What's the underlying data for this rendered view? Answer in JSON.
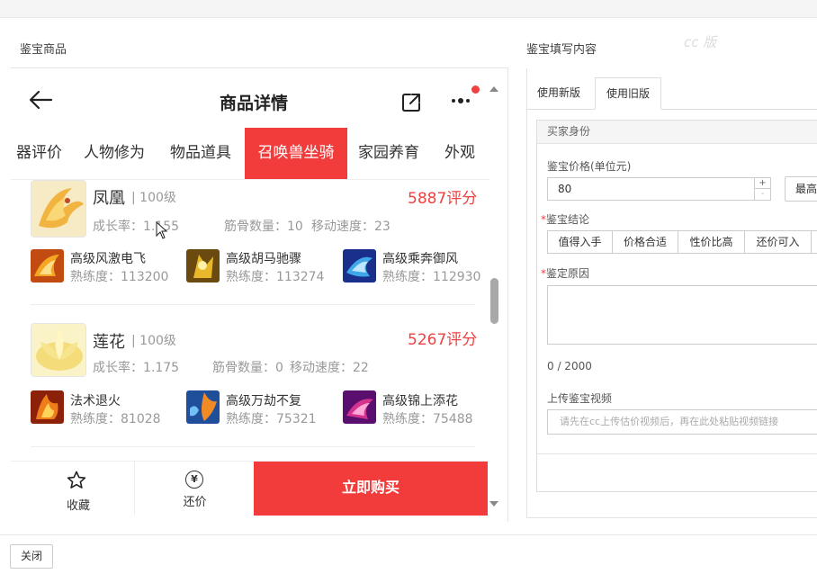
{
  "left_panel": {
    "title": "鉴宝商品"
  },
  "right_panel": {
    "title": "鉴宝填写内容",
    "watermark": "cc 版"
  },
  "phone": {
    "nav": {
      "title": "商品详情"
    },
    "tabs": [
      "器评价",
      "人物修为",
      "物品道具",
      "召唤兽坐骑",
      "家园养育",
      "外观"
    ],
    "active_tab": "召唤兽坐骑",
    "items": [
      {
        "name": "凤凰",
        "level": "| 100级",
        "score": "5887评分",
        "growth": "成长率：1.155",
        "bones": "筋骨数量：10",
        "speed": "移动速度：23",
        "skills": [
          {
            "name": "高级风激电飞",
            "prof": "熟练度：113200"
          },
          {
            "name": "高级胡马驰骤",
            "prof": "熟练度：113274"
          },
          {
            "name": "高级乘奔御风",
            "prof": "熟练度：112930"
          }
        ]
      },
      {
        "name": "莲花",
        "level": "| 100级",
        "score": "5267评分",
        "growth": "成长率：1.175",
        "bones": "筋骨数量：0",
        "speed": "移动速度：22",
        "skills": [
          {
            "name": "法术退火",
            "prof": "熟练度：81028"
          },
          {
            "name": "高级万劫不复",
            "prof": "熟练度：75321"
          },
          {
            "name": "高级锦上添花",
            "prof": "熟练度：75488"
          }
        ]
      }
    ],
    "bottom": {
      "favorite": "收藏",
      "bargain_symbol": "¥",
      "bargain": "还价",
      "buy": "立即购买"
    }
  },
  "form": {
    "tabs": [
      "使用新版",
      "使用旧版"
    ],
    "active_tab": "使用旧版",
    "buyer_section": "买家身份",
    "price_label": "鉴宝价格(单位元)",
    "price_value": "80",
    "step_up": "+",
    "step_down": "-",
    "max_button": "最高",
    "conclusion_label": "鉴宝结论",
    "conclusions": [
      "值得入手",
      "价格合适",
      "性价比高",
      "还价可入"
    ],
    "reason_label": "鉴定原因",
    "reason_counter": "0 / 2000",
    "video_label": "上传鉴宝视频",
    "video_placeholder": "请先在cc上传估价视频后，再在此处粘贴视频链接",
    "required_mark": "*"
  },
  "footer": {
    "close": "关闭"
  },
  "colors": {
    "accent_red": "#f23b3b",
    "score_red": "#f04142"
  }
}
